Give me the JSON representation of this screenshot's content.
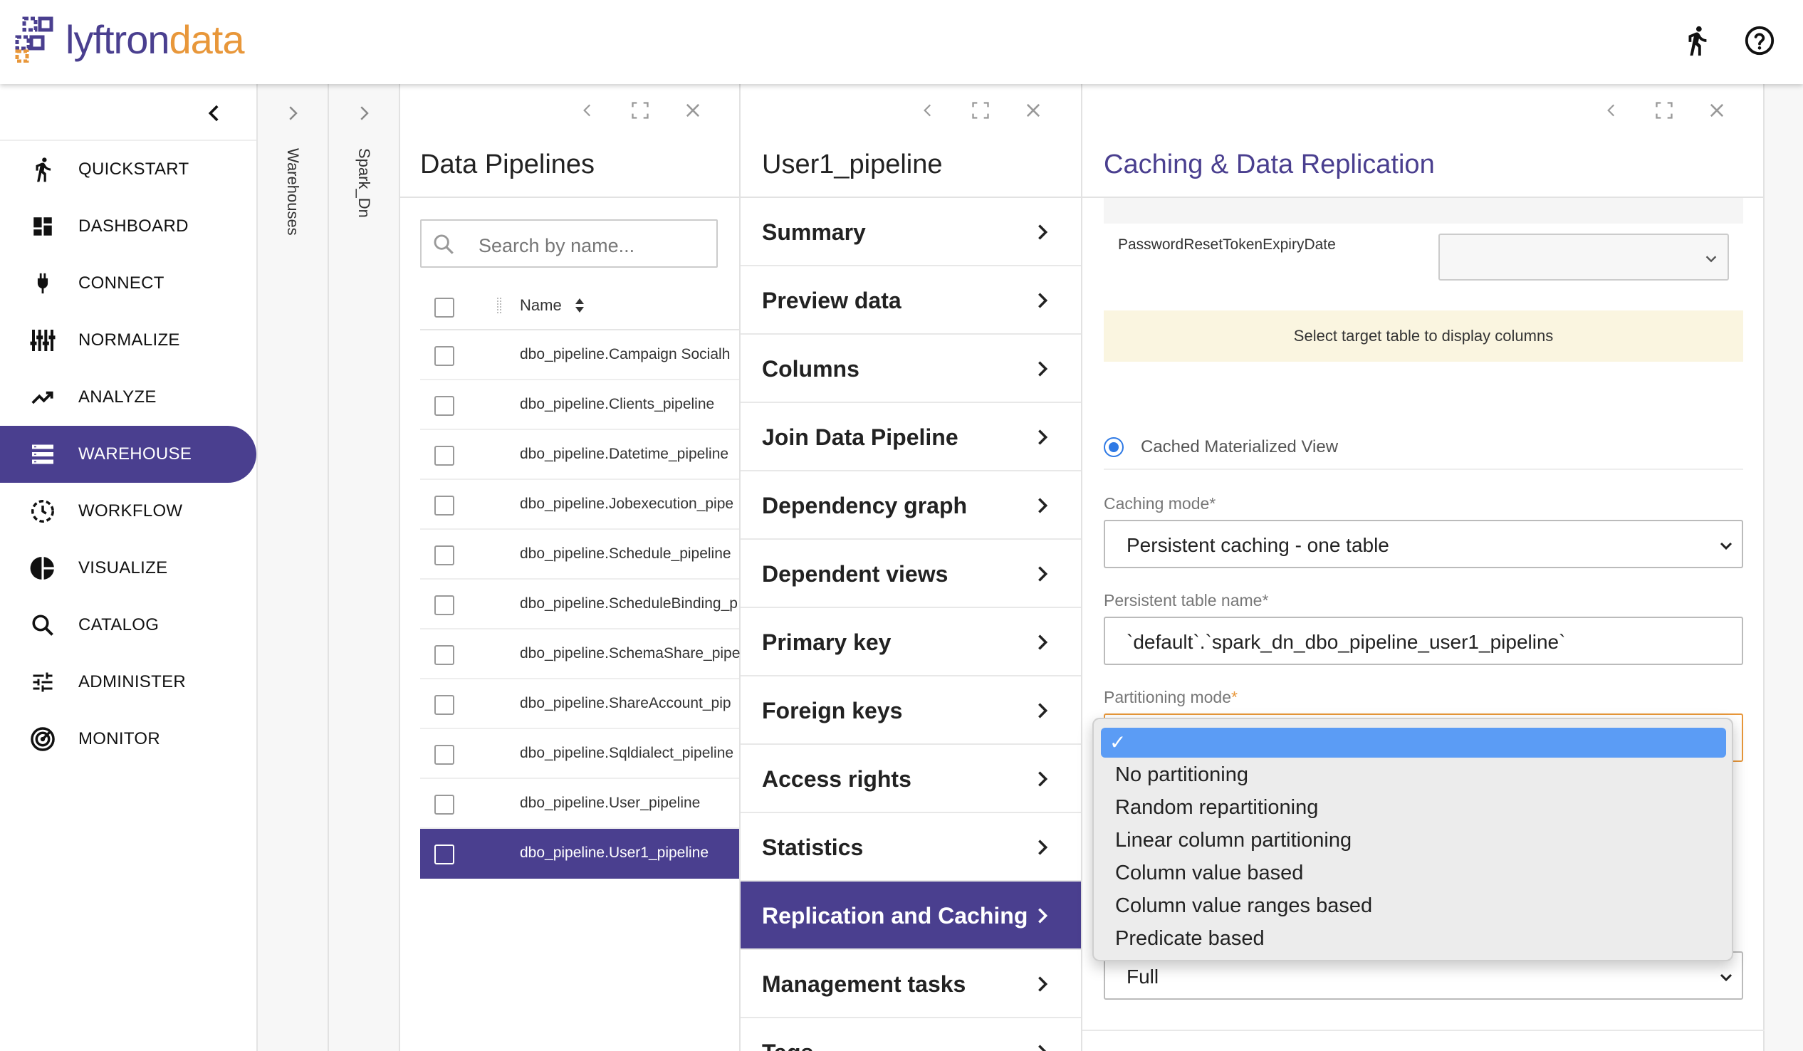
{
  "logo": {
    "part1": "lyftron",
    "part2": "data"
  },
  "topbar": {
    "run_icon": "running-person-icon",
    "help_icon": "help-circle-icon"
  },
  "sidebar": {
    "collapse_icon": "chevron-left-icon",
    "items": [
      {
        "label": "QUICKSTART",
        "icon": "running-person-icon"
      },
      {
        "label": "DASHBOARD",
        "icon": "dashboard-icon"
      },
      {
        "label": "CONNECT",
        "icon": "plug-icon"
      },
      {
        "label": "NORMALIZE",
        "icon": "sliders-icon"
      },
      {
        "label": "ANALYZE",
        "icon": "trending-up-icon"
      },
      {
        "label": "WAREHOUSE",
        "icon": "storage-icon"
      },
      {
        "label": "WORKFLOW",
        "icon": "dashed-clock-icon"
      },
      {
        "label": "VISUALIZE",
        "icon": "pie-chart-icon"
      },
      {
        "label": "CATALOG",
        "icon": "search-icon"
      },
      {
        "label": "ADMINISTER",
        "icon": "tune-icon"
      },
      {
        "label": "MONITOR",
        "icon": "radar-icon"
      }
    ],
    "active": "WAREHOUSE"
  },
  "strips": {
    "warehouses": "Warehouses",
    "spark": "Spark_Dn"
  },
  "pipelines": {
    "title": "Data Pipelines",
    "search_placeholder": "Search by name...",
    "column_name": "Name",
    "rows": [
      "dbo_pipeline.Campaign Socialh",
      "dbo_pipeline.Clients_pipeline",
      "dbo_pipeline.Datetime_pipeline",
      "dbo_pipeline.Jobexecution_pipe",
      "dbo_pipeline.Schedule_pipeline",
      "dbo_pipeline.ScheduleBinding_p",
      "dbo_pipeline.SchemaShare_pipe",
      "dbo_pipeline.ShareAccount_pip",
      "dbo_pipeline.Sqldialect_pipeline",
      "dbo_pipeline.User_pipeline",
      "dbo_pipeline.User1_pipeline"
    ],
    "selected": "dbo_pipeline.User1_pipeline"
  },
  "pipeline_menu": {
    "title": "User1_pipeline",
    "items": [
      "Summary",
      "Preview data",
      "Columns",
      "Join Data Pipeline",
      "Dependency graph",
      "Dependent views",
      "Primary key",
      "Foreign keys",
      "Access rights",
      "Statistics",
      "Replication and Caching",
      "Management tasks",
      "Tags"
    ],
    "active": "Replication and Caching"
  },
  "caching": {
    "title": "Caching & Data Replication",
    "column_field": "PasswordResetTokenExpiryDate",
    "column_select_value": "",
    "notice": "Select target table to display columns",
    "radio_label": "Cached Materialized View",
    "caching_mode_label": "Caching mode*",
    "caching_mode_value": "Persistent caching - one table",
    "persistent_table_label": "Persistent table name*",
    "persistent_table_value": "`default`.`spark_dn_dbo_pipeline_user1_pipeline`",
    "partitioning_label": "Partitioning mode",
    "partitioning_required": "*",
    "refresh_value": "Full",
    "dropdown_options": [
      "No partitioning",
      "Random repartitioning",
      "Linear column partitioning",
      "Column value based",
      "Column value ranges based",
      "Predicate based"
    ],
    "dropdown_checkmark": "✓"
  },
  "colors": {
    "brand": "#4a3f8f",
    "accent": "#e8973a",
    "selected_option": "#5b9cf5",
    "notice_bg": "#faf5e0",
    "radio": "#2f7ae5"
  }
}
